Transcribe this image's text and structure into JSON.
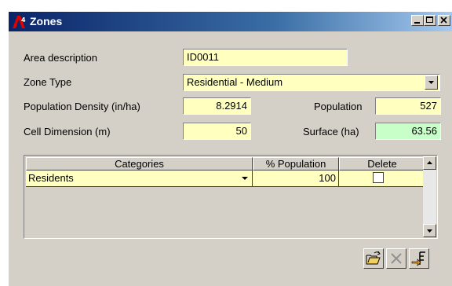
{
  "window": {
    "title": "Zones",
    "minimize_icon": "minimize-icon",
    "maximize_icon": "maximize-icon",
    "close_icon": "close-icon"
  },
  "form": {
    "area_description_label": "Area description",
    "area_description_value": "ID0011",
    "zone_type_label": "Zone Type",
    "zone_type_value": "Residential - Medium",
    "population_density_label": "Population Density (in/ha)",
    "population_density_value": "8.2914",
    "population_label": "Population",
    "population_value": "527",
    "cell_dimension_label": "Cell Dimension (m)",
    "cell_dimension_value": "50",
    "surface_label": "Surface (ha)",
    "surface_value": "63.56"
  },
  "grid": {
    "headers": [
      "Categories",
      "% Population",
      "Delete"
    ],
    "rows": [
      {
        "category": "Residents",
        "percent": "100",
        "delete": false
      }
    ]
  },
  "toolbar": {
    "open_icon": "open-folder-icon",
    "delete_icon": "delete-x-icon",
    "import_icon": "import-icon"
  },
  "colors": {
    "field_bg": "#ffffc0",
    "surface_bg": "#c8ffc8",
    "title_bar": "#0a246a",
    "face": "#d4d0c8"
  }
}
